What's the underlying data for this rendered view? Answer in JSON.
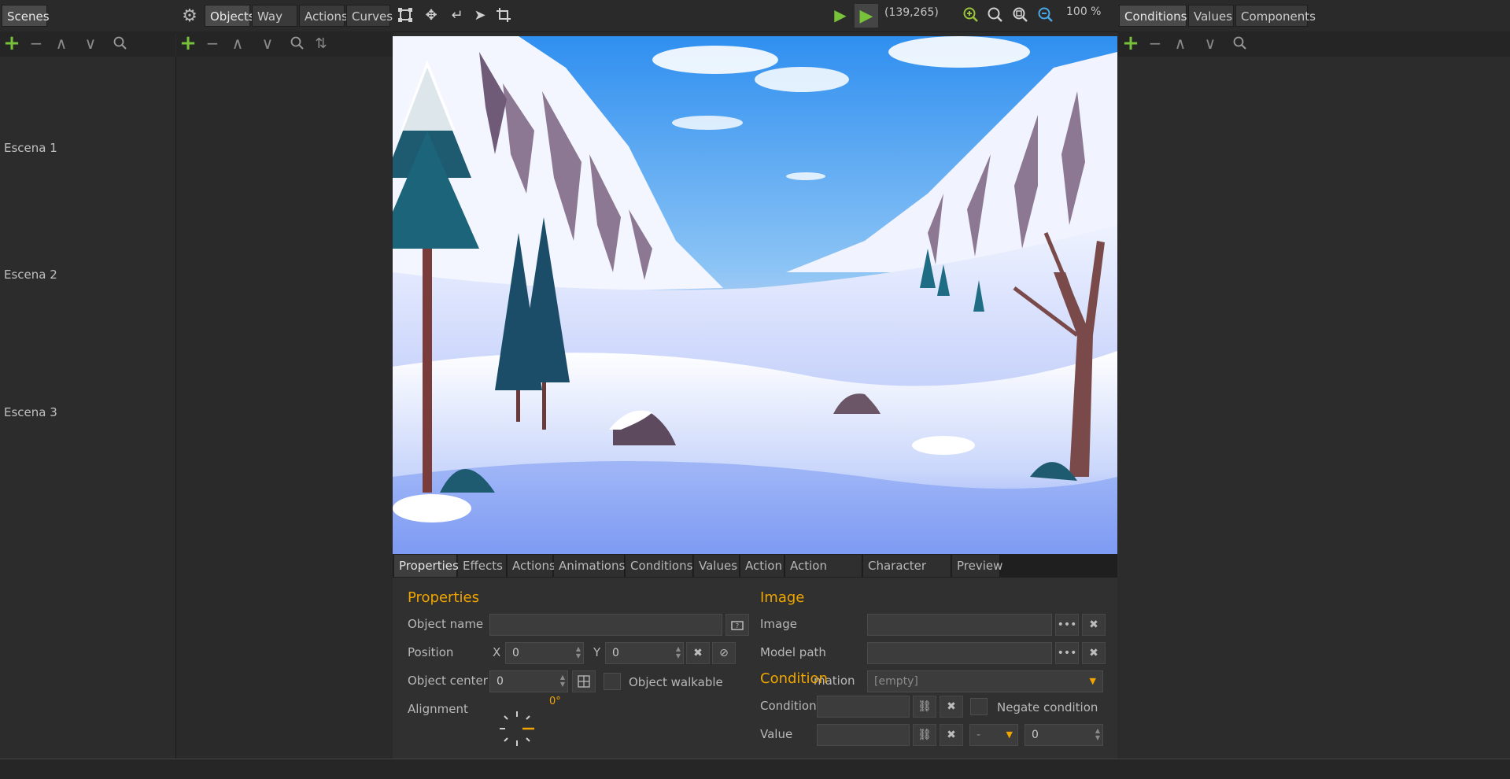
{
  "left_panel": {
    "tab_label": "Scenes",
    "scenes": [
      {
        "label": "Escena 1"
      },
      {
        "label": "Escena 2"
      },
      {
        "label": "Escena 3"
      }
    ]
  },
  "objects_tabs": [
    "Objects",
    "Way sys",
    "Actions",
    "Curves"
  ],
  "toolbar": {
    "coords": "(139,265)",
    "zoom": "100 %"
  },
  "right_tabs": [
    "Conditions",
    "Values",
    "Components"
  ],
  "bottom_tabs": [
    "Properties",
    "Effects",
    "Actions",
    "Animations",
    "Conditions",
    "Values",
    "Action",
    "Action areas",
    "Character size",
    "Preview"
  ],
  "properties": {
    "heading": "Properties",
    "object_name_label": "Object name",
    "object_name_value": "",
    "position_label": "Position",
    "x_label": "X",
    "x_value": "0",
    "y_label": "Y",
    "y_value": "0",
    "object_center_label": "Object center",
    "object_center_value": "0",
    "object_walkable_label": "Object walkable",
    "alignment_label": "Alignment",
    "alignment_angle": "0°"
  },
  "image": {
    "heading": "Image",
    "image_label": "Image",
    "model_path_label": "Model path",
    "default_animation_label": "mation",
    "default_animation_value": "[empty]"
  },
  "condition": {
    "heading": "Condition",
    "condition_label": "Condition",
    "negate_label": "Negate condition",
    "value_label": "Value",
    "operator_value": "-",
    "value_number": "0"
  },
  "colors": {
    "accent": "#f0a500",
    "add_green": "#78c13a",
    "background": "#2b2b2b"
  }
}
